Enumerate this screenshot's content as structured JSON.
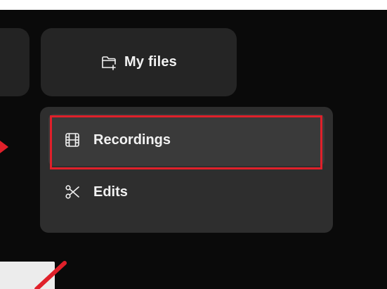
{
  "myfiles_button": {
    "label": "My files",
    "icon": "folder-plus-icon"
  },
  "menu": {
    "items": [
      {
        "label": "Recordings",
        "icon": "film-icon",
        "selected": true
      },
      {
        "label": "Edits",
        "icon": "scissors-icon",
        "selected": false
      }
    ]
  },
  "annotation": {
    "color": "#e0202a"
  }
}
